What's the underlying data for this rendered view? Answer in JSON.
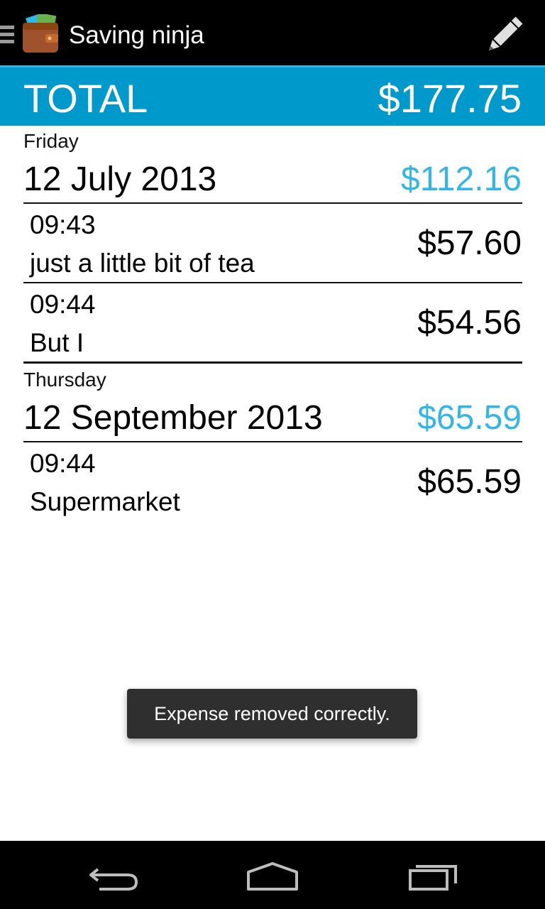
{
  "app": {
    "title": "Saving ninja",
    "icons": {
      "drawer": "drawer-menu-icon",
      "app": "wallet-icon",
      "edit": "pencil-icon"
    }
  },
  "colors": {
    "accent": "#33b5e5",
    "total_bar": "#0099cc",
    "actionbar": "#000000"
  },
  "summary": {
    "label": "TOTAL",
    "amount": "$177.75"
  },
  "days": [
    {
      "weekday": "Friday",
      "date": "12 July 2013",
      "total": "$112.16",
      "expenses": [
        {
          "time": "09:43",
          "description": "just a little bit of tea",
          "amount": "$57.60"
        },
        {
          "time": "09:44",
          "description": "But I",
          "amount": "$54.56"
        }
      ]
    },
    {
      "weekday": "Thursday",
      "date": "12 September 2013",
      "total": "$65.59",
      "expenses": [
        {
          "time": "09:44",
          "description": "Supermarket",
          "amount": "$65.59"
        }
      ]
    }
  ],
  "toast": {
    "message": "Expense removed correctly."
  },
  "navbar": {
    "icons": [
      "back-icon",
      "home-icon",
      "recent-apps-icon"
    ]
  }
}
